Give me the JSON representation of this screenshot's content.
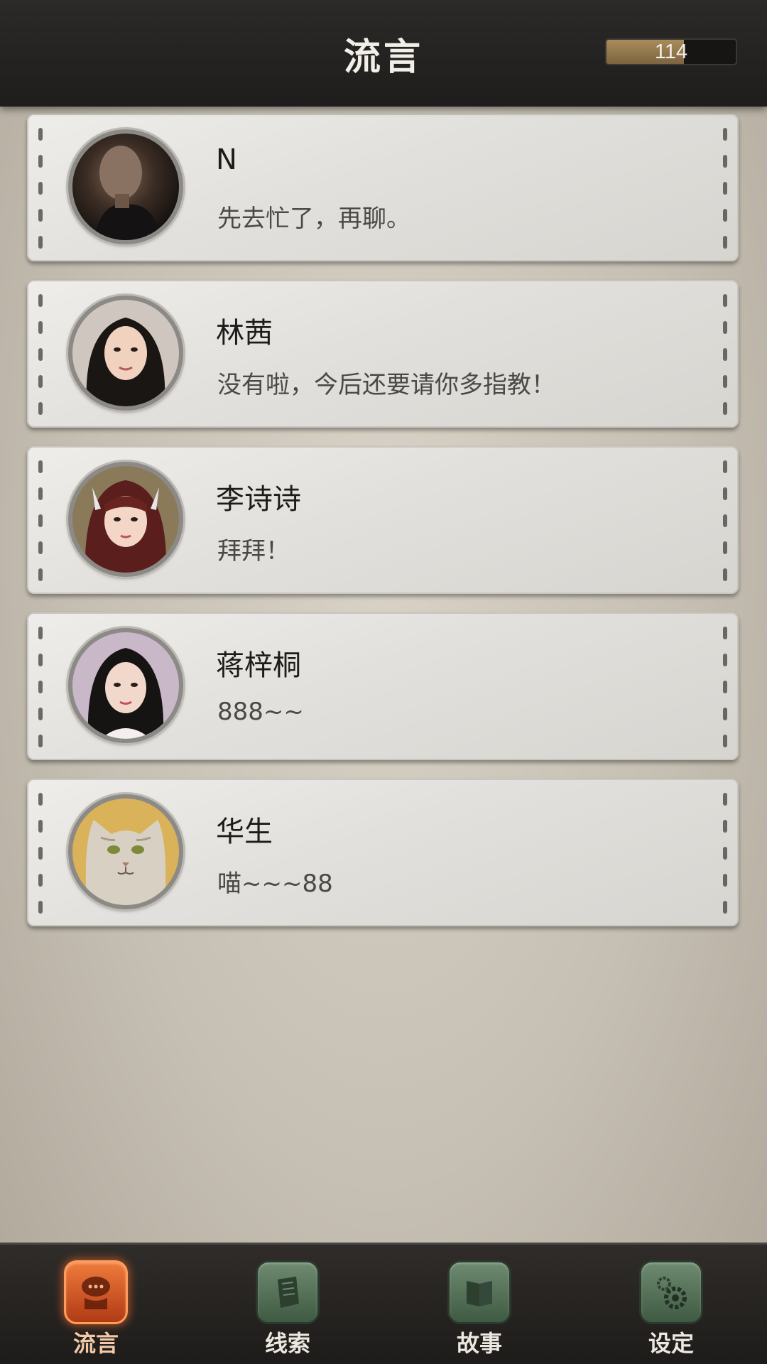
{
  "header": {
    "title": "流言",
    "energy_value": "114",
    "energy_fraction": 0.6
  },
  "chats": [
    {
      "name": "N",
      "message": "先去忙了，再聊。",
      "avatar": "man-portrait-icon"
    },
    {
      "name": "林茜",
      "message": "没有啦，今后还要请你多指教！",
      "avatar": "woman-portrait-icon"
    },
    {
      "name": "李诗诗",
      "message": "拜拜！",
      "avatar": "girl-portrait-icon"
    },
    {
      "name": "蒋梓桐",
      "message": "888~~",
      "avatar": "woman-portrait-icon"
    },
    {
      "name": "华生",
      "message": "喵~~~88",
      "avatar": "cat-portrait-icon"
    }
  ],
  "nav": {
    "items": [
      {
        "label": "流言",
        "icon": "chat-bubble-icon",
        "active": true
      },
      {
        "label": "线索",
        "icon": "paper-scroll-icon",
        "active": false
      },
      {
        "label": "故事",
        "icon": "book-icon",
        "active": false
      },
      {
        "label": "设定",
        "icon": "gear-icon",
        "active": false
      }
    ]
  },
  "colors": {
    "header_bg": "#1f1d1c",
    "card_bg": "#e4e2de",
    "nav_active": "#e0642a",
    "nav_inactive": "#4f6b52",
    "energy_fill": "#a98c5a"
  }
}
